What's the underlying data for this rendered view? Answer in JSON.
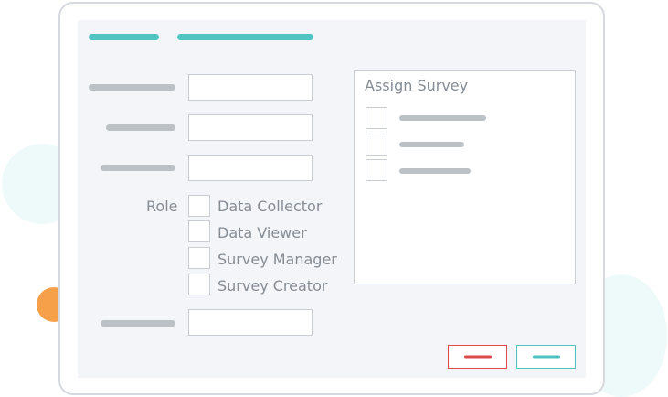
{
  "form": {
    "role_label": "Role",
    "roles": [
      {
        "label": "Data Collector"
      },
      {
        "label": "Data Viewer"
      },
      {
        "label": "Survey Manager"
      },
      {
        "label": "Survey Creator"
      }
    ]
  },
  "assign": {
    "title": "Assign Survey"
  },
  "colors": {
    "accent": "#4fc4c2",
    "danger": "#e0474c",
    "placeholder": "#bcc1c6",
    "highlight": "#f7a04a"
  }
}
